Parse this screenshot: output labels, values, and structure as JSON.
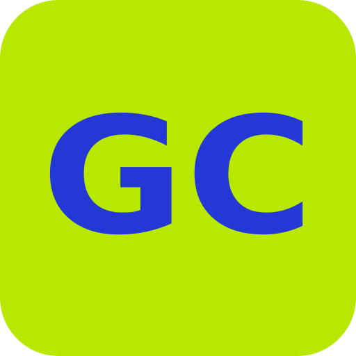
{
  "icon": {
    "monogram": "GC",
    "background_color": "#b9e800",
    "text_color": "#2438d6"
  }
}
